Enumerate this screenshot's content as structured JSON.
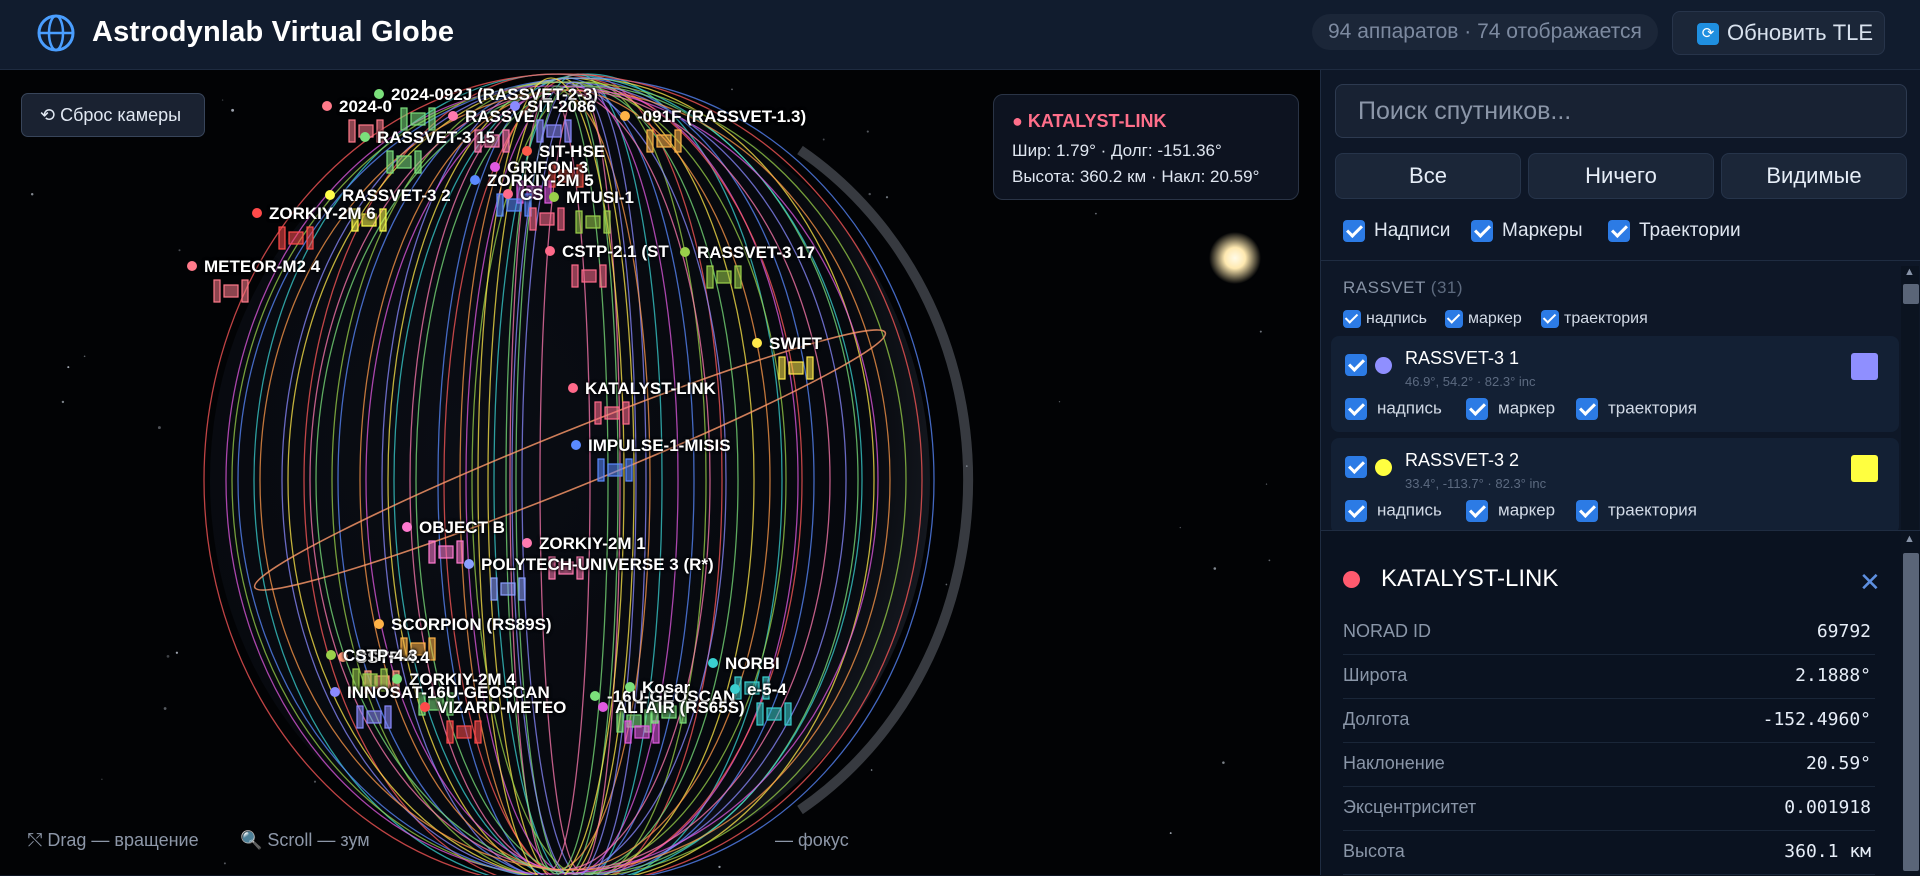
{
  "header": {
    "title": "Astrodynlab Virtual Globe",
    "count_badge": "94 аппаратов · 74 отображается",
    "refresh_label": "Обновить TLE"
  },
  "viewport": {
    "reset_label": "⟲ Сброс камеры",
    "info": {
      "name": "● KATALYST-LINK",
      "line1": "Шир: 1.79° · Долг: -151.36°",
      "line2": "Высота: 360.2 км · Накл: 20.59°"
    },
    "hints": {
      "drag": "⤲ Drag — вращение",
      "scroll": "🔍 Scroll — зум",
      "focus": "— фокус"
    },
    "labels": [
      {
        "text": "2024-092J (RASSVET-2-3)",
        "color": "#7be07b"
      },
      {
        "text": "2024-0",
        "color": "#ff7a8a"
      },
      {
        "text": "RASSVE",
        "color": "#ff7ab0"
      },
      {
        "text": "SIT-2086",
        "color": "#8a8aff"
      },
      {
        "text": "-091F (RASSVET-1.3)",
        "color": "#ffb347"
      },
      {
        "text": "RASSVET-3 15",
        "color": "#7be07b"
      },
      {
        "text": "SIT-HSE",
        "color": "#ff5a4a"
      },
      {
        "text": "GRIFON-3",
        "color": "#e05ae0"
      },
      {
        "text": "ZORKIY-2M 5",
        "color": "#5a8aff"
      },
      {
        "text": "RASSVET-3 2",
        "color": "#ffff4a"
      },
      {
        "text": "ZORKIY-2M 6",
        "color": "#ff4a4a"
      },
      {
        "text": "CS",
        "color": "#ff6a8a"
      },
      {
        "text": "MTUSI-1",
        "color": "#9ad04a"
      },
      {
        "text": "METEOR-M2 4",
        "color": "#ff7a8a"
      },
      {
        "text": "CSTP-2.1 (ST",
        "color": "#ff6a8a"
      },
      {
        "text": "RASSVET-3 17",
        "color": "#9ad04a"
      },
      {
        "text": "SWIFT",
        "color": "#ffe84a"
      },
      {
        "text": "KATALYST-LINK",
        "color": "#ff6a8a"
      },
      {
        "text": "IMPULSE-1-MISIS",
        "color": "#5a8aff"
      },
      {
        "text": "OBJECT B",
        "color": "#ff7ad0"
      },
      {
        "text": "ZORKIY-2M 1",
        "color": "#ff7ab0"
      },
      {
        "text": "POLYTECH-UNIVERSE 3 (R*)",
        "color": "#8aa0ff"
      },
      {
        "text": "SCORPION (RS89S)",
        "color": "#ffb347"
      },
      {
        "text": "NORBI",
        "color": "#3ad0d0"
      },
      {
        "text": "CSTP-4.4",
        "color": "#ff9a7a"
      },
      {
        "text": "ZORKIY-2M 4",
        "color": "#7be07b"
      },
      {
        "text": "INNOSAT-16U-GEOSCAN",
        "color": "#8a8aff"
      },
      {
        "text": "-16U-GEOSCAN",
        "color": "#7be07b"
      },
      {
        "text": "VIZARD-METEO",
        "color": "#ff4a4a"
      },
      {
        "text": "ALTAIR (RS65S)",
        "color": "#e05ae0"
      },
      {
        "text": "Kosar",
        "color": "#7be07b"
      },
      {
        "text": "e-5-4",
        "color": "#3ad0d0"
      },
      {
        "text": "CSTP-4.3",
        "color": "#9ad04a"
      }
    ]
  },
  "panel": {
    "search_placeholder": "Поиск спутников...",
    "seg_all": "Все",
    "seg_none": "Ничего",
    "seg_visible": "Видимые",
    "opt_labels": "Надписи",
    "opt_markers": "Маркеры",
    "opt_tracks": "Траектории",
    "group": {
      "name": "RASSVET",
      "count": "(31)",
      "label": "надпись",
      "marker": "маркер",
      "track": "траектория"
    },
    "sats": [
      {
        "name": "RASSVET-3 1",
        "meta": "46.9°, 54.2° · 82.3° inc",
        "color": "#8f8fff",
        "label": "надпись",
        "marker": "маркер",
        "track": "траектория"
      },
      {
        "name": "RASSVET-3 2",
        "meta": "33.4°, -113.7° · 82.3° inc",
        "color": "#ffff40",
        "label": "надпись",
        "marker": "маркер",
        "track": "траектория"
      }
    ]
  },
  "detail": {
    "title": "KATALYST-LINK",
    "color": "#ff5a6e",
    "close": "✕",
    "rows": [
      {
        "k": "NORAD ID",
        "v": "69792"
      },
      {
        "k": "Широта",
        "v": "2.1888°"
      },
      {
        "k": "Долгота",
        "v": "-152.4960°"
      },
      {
        "k": "Наклонение",
        "v": "20.59°"
      },
      {
        "k": "Эксцентриситет",
        "v": "0.001918"
      },
      {
        "k": "Высота",
        "v": "360.1 км"
      }
    ]
  }
}
